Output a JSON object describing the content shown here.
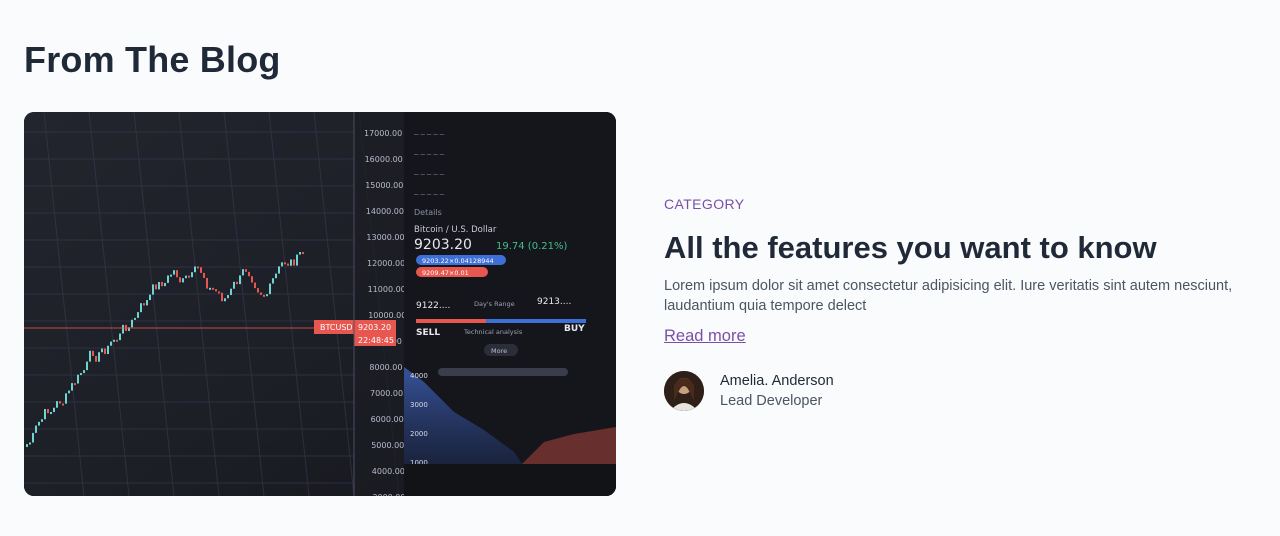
{
  "section": {
    "title": "From The Blog"
  },
  "post": {
    "category": "CATEGORY",
    "title": "All the features you want to know",
    "excerpt": "Lorem ipsum dolor sit amet consectetur adipisicing elit. Iure veritatis sint autem nesciunt, laudantium quia tempore delect",
    "read_more": "Read more",
    "author": {
      "name": "Amelia. Anderson",
      "role": "Lead Developer"
    }
  },
  "image": {
    "ticker": "BTCUSD",
    "last_price": "9203.20",
    "time": "22:48:45",
    "pair": "Bitcoin / U.S. Dollar",
    "price": "9203.20",
    "change": "19.74 (0.21%)",
    "bid": "9203.22×0.04128944",
    "ask": "9209.47×0.01",
    "range_low": "9122....",
    "range_label": "Day's Range",
    "range_high": "9213....",
    "sell": "SELL",
    "buy": "BUY",
    "tech_label": "Technical analysis",
    "more": "More",
    "details": "Details",
    "price_axis": [
      "17000.00",
      "16000.00",
      "15000.00",
      "14000.00",
      "13000.00",
      "12000.00",
      "11000.00",
      "10000.00",
      "9000.00",
      "8000.00",
      "7000.00",
      "6000.00",
      "5000.00",
      "4000.00",
      "3000.00"
    ],
    "depth_axis": [
      "4000",
      "3000",
      "2000",
      "1000"
    ]
  }
}
